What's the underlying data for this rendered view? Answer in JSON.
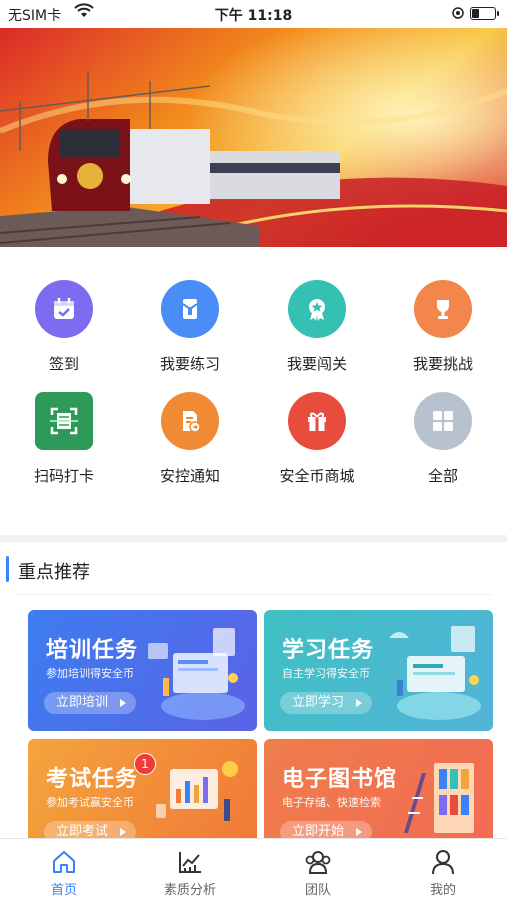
{
  "status_bar": {
    "carrier": "无SIM卡",
    "time": "下午 11:18"
  },
  "grid": [
    {
      "label": "签到",
      "icon": "calendar-check-icon",
      "color": "#7b6cf0"
    },
    {
      "label": "我要练习",
      "icon": "notebook-icon",
      "color": "#4a8df6"
    },
    {
      "label": "我要闯关",
      "icon": "medal-icon",
      "color": "#34c1b4"
    },
    {
      "label": "我要挑战",
      "icon": "trophy-icon",
      "color": "#f2864b"
    },
    {
      "label": "扫码打卡",
      "icon": "scan-icon",
      "color": "#2e9a5a"
    },
    {
      "label": "安控通知",
      "icon": "notice-doc-icon",
      "color": "#f08a34"
    },
    {
      "label": "安全币商城",
      "icon": "gift-icon",
      "color": "#e74c3c"
    },
    {
      "label": "全部",
      "icon": "all-grid-icon",
      "color": "#b8c2cf"
    }
  ],
  "section": {
    "title": "重点推荐"
  },
  "cards": [
    {
      "title": "培训任务",
      "subtitle": "参加培训得安全币",
      "button": "立即培训",
      "color_from": "#3d7cf0",
      "color_to": "#5a63e6"
    },
    {
      "title": "学习任务",
      "subtitle": "自主学习得安全币",
      "button": "立即学习",
      "color_from": "#3fc0c2",
      "color_to": "#52b3d9"
    },
    {
      "title": "考试任务",
      "subtitle": "参加考试赢安全币",
      "button": "立即考试",
      "badge": "1",
      "color_from": "#f4a43d",
      "color_to": "#f07a38"
    },
    {
      "title": "电子图书馆",
      "subtitle": "电子存储、快速检索",
      "button": "立即开始",
      "color_from": "#ef7d4b",
      "color_to": "#f26b53"
    }
  ],
  "tabbar": [
    {
      "label": "首页",
      "icon": "home-icon",
      "active": true
    },
    {
      "label": "素质分析",
      "icon": "chart-icon",
      "active": false
    },
    {
      "label": "团队",
      "icon": "team-icon",
      "active": false
    },
    {
      "label": "我的",
      "icon": "user-icon",
      "active": false
    }
  ],
  "colors": {
    "accent": "#3b82f6"
  }
}
